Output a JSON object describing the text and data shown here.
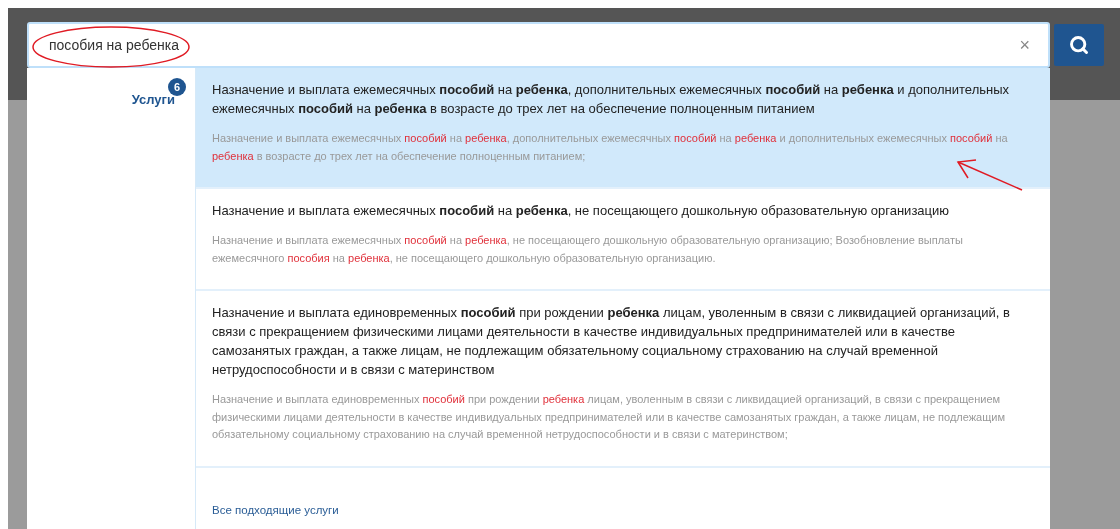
{
  "search": {
    "value": "пособия на ребенка",
    "clear": "×"
  },
  "categories": [
    {
      "label": "Услуги",
      "count": "6",
      "selected": true
    }
  ],
  "results": [
    {
      "title": "Назначение и выплата ежемесячных **пособий** на **ребенка**, дополнительных ежемесячных **пособий** на **ребенка** и дополнительных ежемесячных **пособий** на **ребенка** в возрасте до трех лет на обеспечение полноценным питанием",
      "description": "Назначение и выплата ежемесячных **пособий** на **ребенка**, дополнительных ежемесячных **пособий** на **ребенка** и дополнительных ежемесячных **пособий** на **ребенка** в возрасте до трех лет на обеспечение полноценным питанием;",
      "selected": true
    },
    {
      "title": "Назначение и выплата ежемесячных **пособий** на **ребенка**, не посещающего дошкольную образовательную организацию",
      "description": "Назначение и выплата ежемесячных **пособий** на **ребенка**, не посещающего дошкольную образовательную организацию; Возобновление выплаты ежемесячного **пособия** на **ребенка**, не посещающего дошкольную образовательную организацию.",
      "selected": false
    },
    {
      "title": "Назначение и выплата единовременных **пособий** при рождении **ребенка** лицам, уволенным в связи с ликвидацией организаций, в связи с прекращением физическими лицами деятельности в качестве индивидуальных предпринимателей или в качестве самозанятых граждан, а также лицам, не подлежащим обязательному социальному страхованию на случай временной нетрудоспособности и в связи с материнством",
      "description": "Назначение и выплата единовременных **пособий** при рождении **ребенка** лицам, уволенным в связи с ликвидацией организаций, в связи с прекращением физическими лицами деятельности в качестве индивидуальных предпринимателей или в качестве самозанятых граждан, а также лицам, не подлежащим обязательному социальному страхованию на случай временной нетрудоспособности и в связи с материнством;",
      "selected": false
    }
  ],
  "all_link": "Все подходящие услуги"
}
